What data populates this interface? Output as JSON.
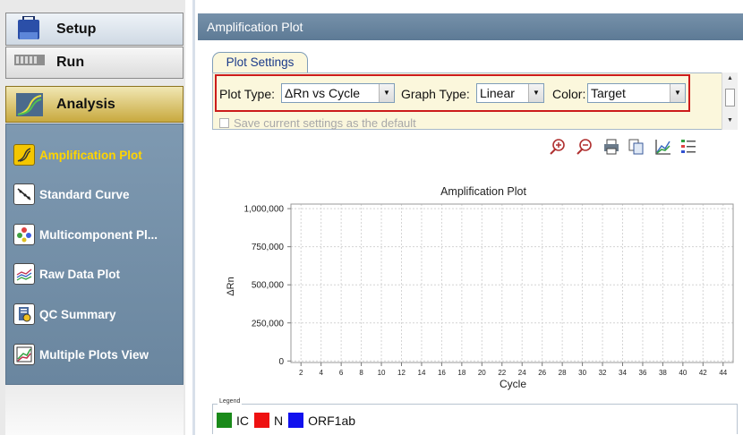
{
  "nav": {
    "setup_label": "Setup",
    "run_label": "Run",
    "analysis_label": "Analysis",
    "analysis_items": [
      {
        "label": "Amplification Plot",
        "icon": "amplification-plot-icon",
        "active": true
      },
      {
        "label": "Standard Curve",
        "icon": "standard-curve-icon",
        "active": false
      },
      {
        "label": "Multicomponent Pl...",
        "icon": "multicomponent-plot-icon",
        "active": false
      },
      {
        "label": "Raw Data Plot",
        "icon": "raw-data-plot-icon",
        "active": false
      },
      {
        "label": "QC Summary",
        "icon": "qc-summary-icon",
        "active": false
      },
      {
        "label": "Multiple Plots View",
        "icon": "multiple-plots-view-icon",
        "active": false
      }
    ]
  },
  "panel": {
    "title": "Amplification Plot",
    "settings_tab": "Plot Settings",
    "plot_type_label": "Plot Type:",
    "plot_type_value": "ΔRn vs Cycle",
    "graph_type_label": "Graph Type:",
    "graph_type_value": "Linear",
    "color_label": "Color:",
    "color_value": "Target",
    "save_default_label": "Save current settings as the default"
  },
  "toolbar": [
    "zoom-in-icon",
    "zoom-out-icon",
    "print-icon",
    "copy-icon",
    "plot-properties-icon",
    "legend-toggle-icon"
  ],
  "chart_data": {
    "type": "line",
    "title": "Amplification Plot",
    "xlabel": "Cycle",
    "ylabel": "ΔRn",
    "y_ticks": [
      "1,000,000",
      "750,000",
      "500,000",
      "250,000",
      "0"
    ],
    "y_tick_values": [
      1000000,
      750000,
      500000,
      250000,
      0
    ],
    "x_ticks": [
      "2",
      "4",
      "6",
      "8",
      "10",
      "12",
      "14",
      "16",
      "18",
      "20",
      "22",
      "24",
      "26",
      "28",
      "30",
      "32",
      "34",
      "36",
      "38",
      "40",
      "42",
      "44"
    ],
    "xlim": [
      1,
      45
    ],
    "ylim": [
      -10000,
      1030000
    ],
    "grid": true,
    "series": []
  },
  "legend": {
    "caption": "Legend",
    "items": [
      {
        "label": "IC",
        "color": "#1a8a1a"
      },
      {
        "label": "N",
        "color": "#ee1111"
      },
      {
        "label": "ORF1ab",
        "color": "#1111ee"
      }
    ]
  }
}
